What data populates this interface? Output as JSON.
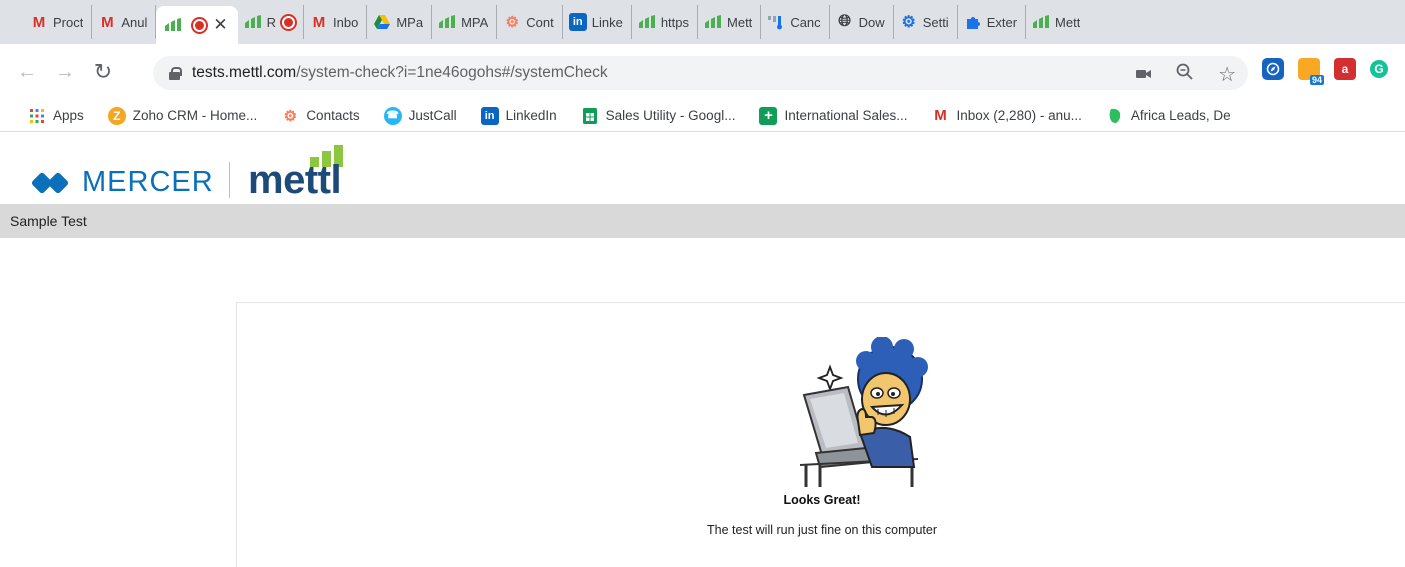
{
  "browser": {
    "tabs": [
      {
        "title": "Proct",
        "icon": "gmail-icon",
        "active": false
      },
      {
        "title": "Anul",
        "icon": "gmail-icon",
        "active": false
      },
      {
        "title": "",
        "icon": "mettl-icon",
        "active": true,
        "recording": true
      },
      {
        "title": "R",
        "icon": "mettl-icon",
        "active": false,
        "recording": true
      },
      {
        "title": "Inbo",
        "icon": "gmail-icon",
        "active": false
      },
      {
        "title": "MPa",
        "icon": "drive-icon",
        "active": false
      },
      {
        "title": "MPA",
        "icon": "mettl-icon",
        "active": false
      },
      {
        "title": "Cont",
        "icon": "hubspot-icon",
        "active": false
      },
      {
        "title": "Linke",
        "icon": "linkedin-icon",
        "active": false
      },
      {
        "title": "https",
        "icon": "mettl-icon",
        "active": false
      },
      {
        "title": "Mett",
        "icon": "mettl-icon",
        "active": false
      },
      {
        "title": "Canc",
        "icon": "bars-icon",
        "active": false
      },
      {
        "title": "Dow",
        "icon": "globe-icon",
        "active": false
      },
      {
        "title": "Setti",
        "icon": "gear-icon",
        "active": false
      },
      {
        "title": "Exter",
        "icon": "puzzle-icon",
        "active": false
      },
      {
        "title": "Mett",
        "icon": "mettl-icon",
        "active": false
      }
    ],
    "url": {
      "host": "tests.mettl.com",
      "path": "/system-check?i=1ne46ogohs#/systemCheck"
    },
    "extension_badge": "94",
    "bookmarks": [
      {
        "label": "Apps",
        "icon": "apps-grid-icon"
      },
      {
        "label": "Zoho CRM - Home...",
        "icon": "zoho-icon"
      },
      {
        "label": "Contacts",
        "icon": "hubspot-icon"
      },
      {
        "label": "JustCall",
        "icon": "justcall-icon"
      },
      {
        "label": "LinkedIn",
        "icon": "linkedin-icon"
      },
      {
        "label": "Sales Utility - Googl...",
        "icon": "sheets-icon"
      },
      {
        "label": "International Sales...",
        "icon": "plus-doc-icon"
      },
      {
        "label": "Inbox (2,280) - anu...",
        "icon": "gmail-icon"
      },
      {
        "label": "Africa Leads, De",
        "icon": "evernote-icon"
      }
    ]
  },
  "page": {
    "brand_mercer": "MERCER",
    "brand_mettl": "mettl",
    "breadcrumb": "Sample Test",
    "status_title": "Looks Great!",
    "status_message": "The test will run just fine on this computer"
  },
  "colors": {
    "tab_strip": "#dee1e6",
    "mercer_blue": "#0a70b9",
    "mettl_navy": "#1e4a7a",
    "mettl_green": "#8dc63f",
    "subheader_bg": "#d9d9d9",
    "recording_red": "#d93025"
  }
}
